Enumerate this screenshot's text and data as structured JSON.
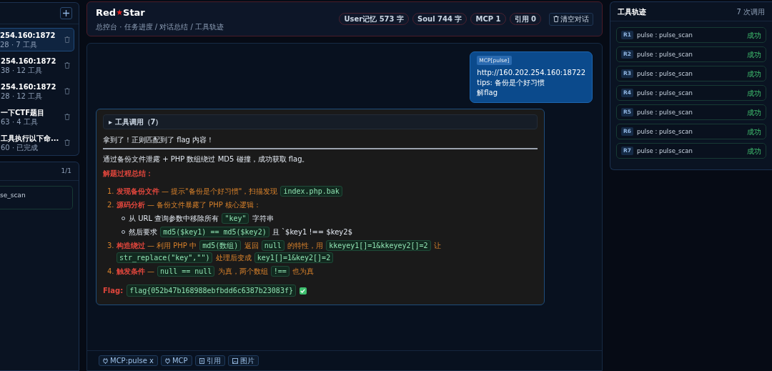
{
  "sessions": {
    "items": [
      {
        "title": "254.160:1872",
        "meta": "28 · 7 工具",
        "selected": true
      },
      {
        "title": "254.160:1872",
        "meta": "38 · 12 工具",
        "selected": false
      },
      {
        "title": "254.160:1872",
        "meta": "28 · 12 工具",
        "selected": false
      },
      {
        "title": "一下CTF题目",
        "meta": "63 · 4 工具",
        "selected": false
      },
      {
        "title": "工具执行以下命...",
        "meta": "60 · 已完成",
        "selected": false
      }
    ]
  },
  "tool_panel": {
    "counter": "1/1",
    "items": [
      "se_scan"
    ]
  },
  "header": {
    "brand_left": "Red",
    "brand_star": "★",
    "brand_right": "Star",
    "subtitle": "总控台 · 任务进度 / 对话总结 / 工具轨迹",
    "chips": [
      "User记忆 573 字",
      "Soul 744 字",
      "MCP 1",
      "引用 0"
    ],
    "clear_button": "清空对话"
  },
  "chat": {
    "user_message": {
      "tag": "MCP[pulse]",
      "lines": [
        "http://160.202.254.160:18722",
        "tips: 备份是个好习惯",
        "解flag"
      ]
    },
    "reply": {
      "tool_calls": "▸ 工具调用（7）",
      "intro": "拿到了！正则匹配到了 flag 内容！",
      "summary": "通过备份文件泄露 + PHP 数组绕过 MD5 碰撞，成功获取 flag。",
      "heading": "解题过程总结：",
      "steps": [
        {
          "number": "1.",
          "segments": [
            {
              "kind": "strong",
              "text": "发现备份文件"
            },
            {
              "kind": "text",
              "text": " — 提示\"备份是个好习惯\"，扫描发现 "
            },
            {
              "kind": "code",
              "text": "index.php.bak"
            }
          ]
        },
        {
          "number": "2.",
          "segments": [
            {
              "kind": "strong",
              "text": "源码分析"
            },
            {
              "kind": "text",
              "text": " — 备份文件暴露了 PHP 核心逻辑："
            }
          ],
          "children": [
            [
              {
                "kind": "plain",
                "text": "从 URL 查询参数中移除所有 "
              },
              {
                "kind": "code",
                "text": "\"key\""
              },
              {
                "kind": "plain",
                "text": " 字符串"
              }
            ],
            [
              {
                "kind": "plain",
                "text": "然后要求 "
              },
              {
                "kind": "code",
                "text": "md5($key1) == md5($key2)"
              },
              {
                "kind": "plain",
                "text": " 且 `$key1 !== $key2$"
              }
            ]
          ]
        },
        {
          "number": "3.",
          "segments": [
            {
              "kind": "strong",
              "text": "构造绕过"
            },
            {
              "kind": "text",
              "text": " — 利用 PHP 中 "
            },
            {
              "kind": "code",
              "text": "md5(数组)"
            },
            {
              "kind": "text",
              "text": " 返回 "
            },
            {
              "kind": "code",
              "text": "null"
            },
            {
              "kind": "text",
              "text": " 的特性，用 "
            },
            {
              "kind": "code",
              "text": "kkeyey1[]=1&kkeyey2[]=2"
            },
            {
              "kind": "text",
              "text": " 让 "
            },
            {
              "kind": "code",
              "text": "str_replace(\"key\",\"\")"
            },
            {
              "kind": "text",
              "text": " 处理后变成 "
            },
            {
              "kind": "code",
              "text": "key1[]=1&key2[]=2"
            }
          ]
        },
        {
          "number": "4.",
          "segments": [
            {
              "kind": "strong",
              "text": "触发条件"
            },
            {
              "kind": "text",
              "text": " — "
            },
            {
              "kind": "code",
              "text": "null == null"
            },
            {
              "kind": "text",
              "text": " 为真，两个数组 "
            },
            {
              "kind": "code",
              "text": "!=="
            },
            {
              "kind": "text",
              "text": " 也为真"
            }
          ]
        }
      ],
      "flag_label": "Flag:",
      "flag_value": "flag{052b47b168988ebfbdd6c6387b23083f}",
      "flag_checked": true
    },
    "composer_chips": [
      {
        "kind": "plug",
        "label": "MCP:pulse x"
      },
      {
        "kind": "plug",
        "label": "MCP"
      },
      {
        "kind": "doc",
        "label": "引用"
      },
      {
        "kind": "image",
        "label": "图片"
      }
    ]
  },
  "trace": {
    "title": "工具轨迹",
    "count": "7 次调用",
    "items": [
      {
        "tag": "R1",
        "name": "pulse : pulse_scan",
        "status": "成功"
      },
      {
        "tag": "R2",
        "name": "pulse : pulse_scan",
        "status": "成功"
      },
      {
        "tag": "R3",
        "name": "pulse : pulse_scan",
        "status": "成功"
      },
      {
        "tag": "R4",
        "name": "pulse : pulse_scan",
        "status": "成功"
      },
      {
        "tag": "R5",
        "name": "pulse : pulse_scan",
        "status": "成功"
      },
      {
        "tag": "R6",
        "name": "pulse : pulse_scan",
        "status": "成功"
      },
      {
        "tag": "R7",
        "name": "pulse : pulse_scan",
        "status": "成功"
      }
    ]
  }
}
